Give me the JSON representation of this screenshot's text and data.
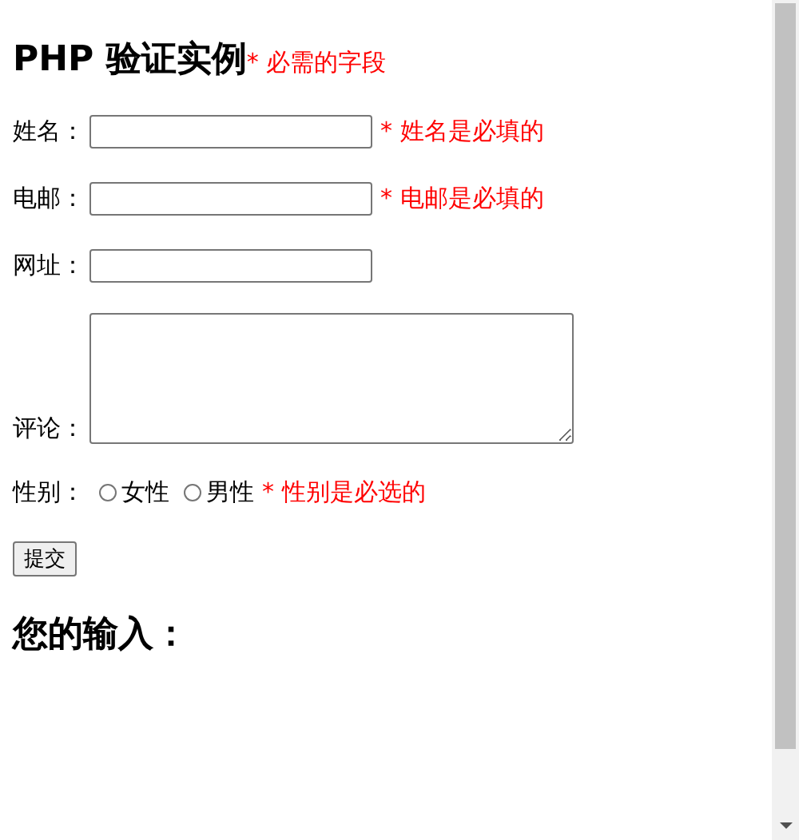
{
  "title": "PHP 验证实例",
  "required_note": "* 必需的字段",
  "fields": [
    {
      "kind": "input",
      "label": "姓名：",
      "error": "* 姓名是必填的"
    },
    {
      "kind": "input",
      "label": "电邮：",
      "error": "* 电邮是必填的"
    },
    {
      "kind": "input",
      "label": "网址："
    },
    {
      "kind": "textarea",
      "label": "评论："
    }
  ],
  "gender": {
    "label": "性别：",
    "options": [
      {
        "label": "女性",
        "checked": false
      },
      {
        "label": "男性",
        "checked": false
      }
    ],
    "error": "* 性别是必选的"
  },
  "submit": "提交",
  "output_heading": "您的输入："
}
